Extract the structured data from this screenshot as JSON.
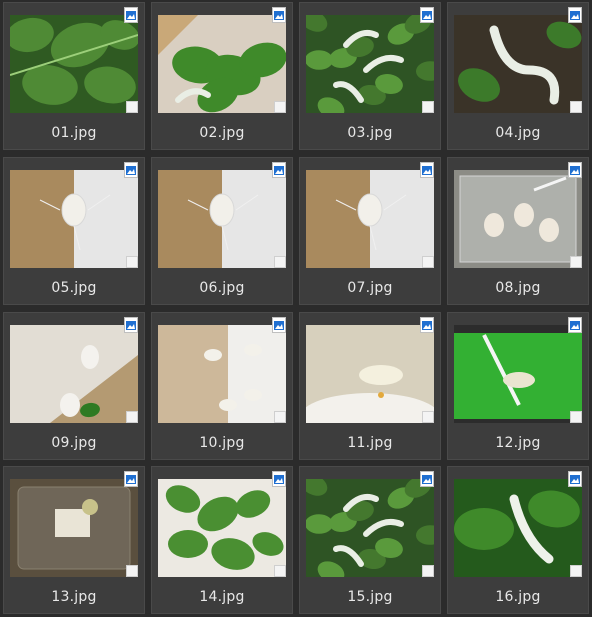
{
  "files": [
    {
      "name": "01.jpg",
      "scene": "leaves"
    },
    {
      "name": "02.jpg",
      "scene": "leaves-box"
    },
    {
      "name": "03.jpg",
      "scene": "worms-leaves"
    },
    {
      "name": "04.jpg",
      "scene": "worms-close"
    },
    {
      "name": "05.jpg",
      "scene": "cocoon-box"
    },
    {
      "name": "06.jpg",
      "scene": "cocoon-box"
    },
    {
      "name": "07.jpg",
      "scene": "cocoon-box"
    },
    {
      "name": "08.jpg",
      "scene": "moths-container"
    },
    {
      "name": "09.jpg",
      "scene": "cocoons-white"
    },
    {
      "name": "10.jpg",
      "scene": "moths-box"
    },
    {
      "name": "11.jpg",
      "scene": "moth-plate"
    },
    {
      "name": "12.jpg",
      "scene": "moth-green"
    },
    {
      "name": "13.jpg",
      "scene": "tray"
    },
    {
      "name": "14.jpg",
      "scene": "leaves-paper"
    },
    {
      "name": "15.jpg",
      "scene": "worms-leaves"
    },
    {
      "name": "16.jpg",
      "scene": "worm-leaf"
    }
  ],
  "colors": {
    "background": "#2b2b2b",
    "tile": "#3d3d3d",
    "label": "#e8e8e8",
    "icon_blue": "#1f6fd1"
  }
}
